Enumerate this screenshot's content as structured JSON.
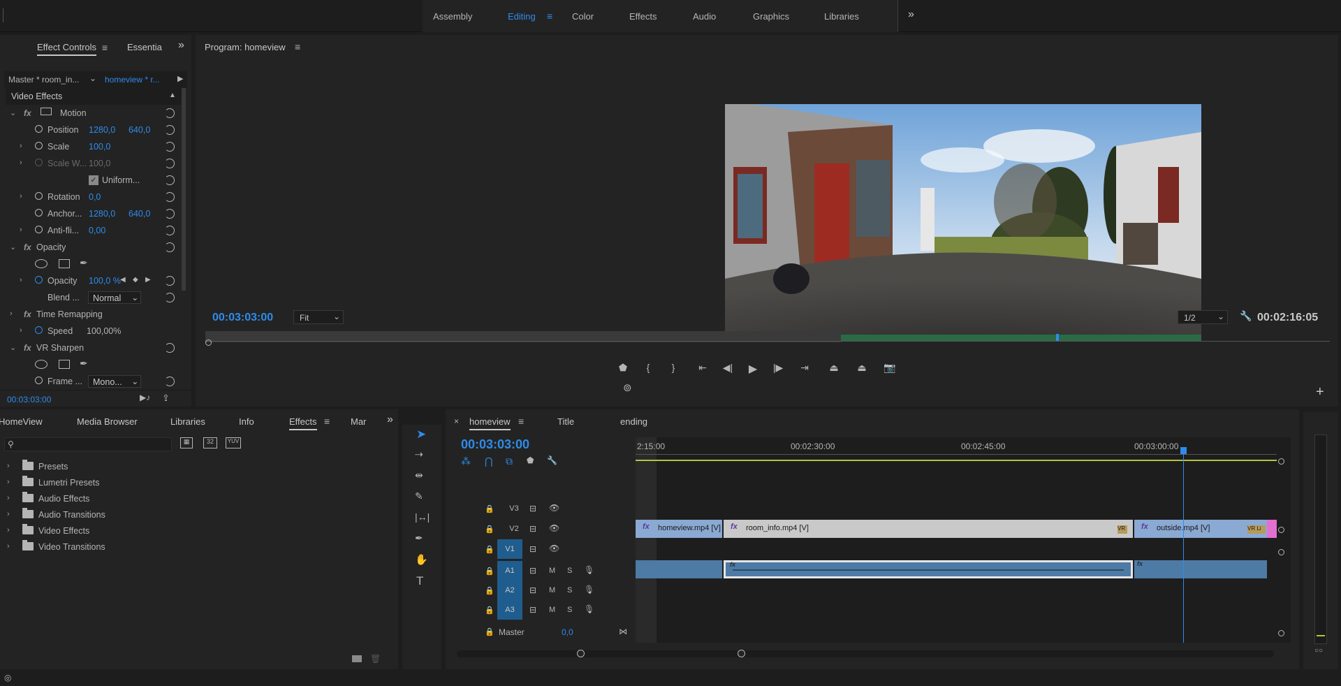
{
  "workspaces": {
    "tabs": [
      "Assembly",
      "Editing",
      "Color",
      "Effects",
      "Audio",
      "Graphics",
      "Libraries"
    ],
    "active": "Editing"
  },
  "effect_controls": {
    "tab_main": "Effect Controls",
    "tab_other": "Essentia",
    "master_label": "Master * room_in...",
    "sequence_label": "homeview * r...",
    "section_title": "Video Effects",
    "motion": "Motion",
    "position_label": "Position",
    "position_x": "1280,0",
    "position_y": "640,0",
    "scale_label": "Scale",
    "scale_value": "100,0",
    "scale_w_label": "Scale W...",
    "scale_w_value": "100,0",
    "uniform_label": "Uniform...",
    "rotation_label": "Rotation",
    "rotation_value": "0,0",
    "anchor_label": "Anchor...",
    "anchor_x": "1280,0",
    "anchor_y": "640,0",
    "antiflicker_label": "Anti-fli...",
    "antiflicker_value": "0,00",
    "opacity_group": "Opacity",
    "opacity_label": "Opacity",
    "opacity_value": "100,0 %",
    "blend_label": "Blend ...",
    "blend_value": "Normal",
    "time_remap": "Time Remapping",
    "speed_label": "Speed",
    "speed_value": "100,00%",
    "vr_sharpen": "VR Sharpen",
    "frame_label": "Frame ...",
    "frame_value": "Mono...",
    "timecode": "00:03:03:00"
  },
  "program_monitor": {
    "title": "Program: homeview",
    "timecode_left": "00:03:03:00",
    "fit": "Fit",
    "resolution": "1/2",
    "timecode_right": "00:02:16:05"
  },
  "effects_panel": {
    "tabs": [
      "HomeView",
      "Media Browser",
      "Libraries",
      "Info",
      "Effects",
      "Mar"
    ],
    "active_tab": "Effects",
    "search_placeholder": "",
    "badge_32": "32",
    "badge_yuv": "YUV",
    "items": [
      "Presets",
      "Lumetri Presets",
      "Audio Effects",
      "Audio Transitions",
      "Video Effects",
      "Video Transitions"
    ]
  },
  "timeline": {
    "tabs": [
      "homeview",
      "Title",
      "ending"
    ],
    "timecode": "00:03:03:00",
    "ruler": [
      "2:15:00",
      "00:02:30:00",
      "00:02:45:00",
      "00:03:00:00"
    ],
    "video_tracks": [
      "V3",
      "V2",
      "V1"
    ],
    "audio_tracks": [
      "A1",
      "A2",
      "A3"
    ],
    "master_label": "Master",
    "master_value": "0,0",
    "mute": "M",
    "solo": "S",
    "clips": {
      "c1": "homeview.mp4 [V]",
      "c2": "room_info.mp4 [V]",
      "c3": "outside.mp4 [V]",
      "vr1": "VR",
      "vr2": "VR Li"
    }
  }
}
